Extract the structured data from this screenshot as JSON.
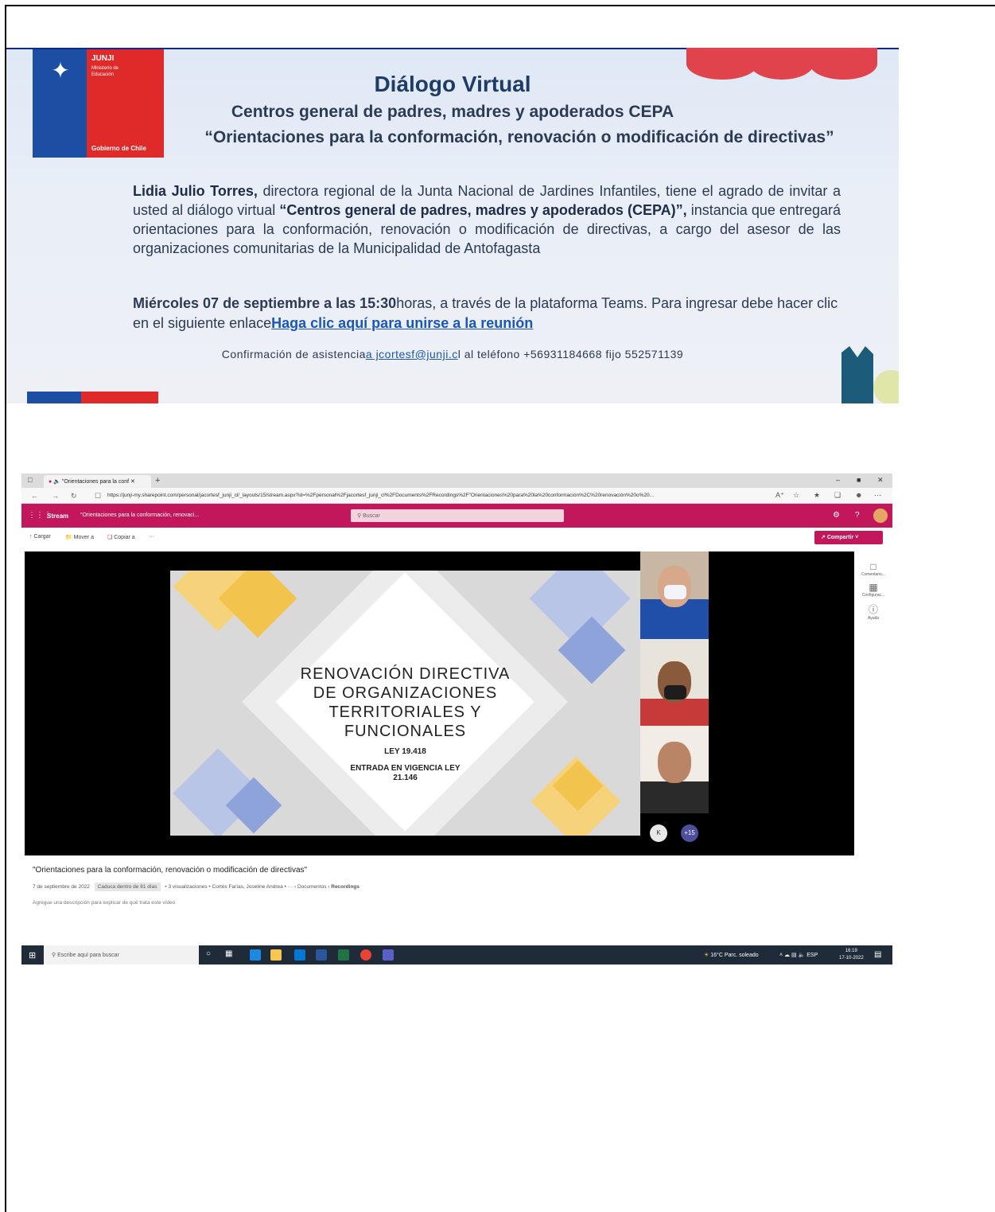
{
  "invitation": {
    "logo": {
      "brand": "JUNJI",
      "ministry": "Ministerio de Educación",
      "government": "Gobierno de Chile"
    },
    "title": "Diálogo Virtual",
    "subtitle": "Centros general de padres, madres y apoderados CEPA",
    "quote": "“Orientaciones para la conformación, renovación o modificación de directivas”",
    "body_name": "Lidia Julio Torres,",
    "body_text1": " directora regional de la Junta Nacional de Jardines Infantiles, tiene el agrado de invitar a usted al diálogo virtual ",
    "body_event": "“Centros general de padres, madres y apoderados (CEPA)”,",
    "body_text2": " instancia que entregará orientaciones para la conformación, renovación o modificación de directivas, a cargo del asesor de las organizaciones comunitarias de la Municipalidad de Antofagasta",
    "date_bold": "Miércoles 07 de septiembre a las 15:30",
    "date_text": "horas, a través de la plataforma Teams. Para ingresar debe hacer clic en el siguiente enlace",
    "join_link": "Haga clic aquí para unirse a la reunión",
    "confirm_prefix": "Confirmación de asistencia",
    "confirm_email": "a jcortesf@junji.c",
    "confirm_suffix": "l al teléfono +56931184668 fijo 552571139",
    "colors": {
      "flag_blue": "#1c4fa3",
      "flag_red": "#e02a2a",
      "title": "#1e3c66"
    }
  },
  "browser": {
    "tab_title": "\"Orientaciones para la conf",
    "url": "https://junji-my.sharepoint.com/personal/jacortesf_junji_cl/_layouts/15/stream.aspx?id=%2Fpersonal%2Fjacortesf_junji_cl%2FDocuments%2FRecordings%2F\"Orientaciones%20para%20la%20conformación%2C%20renovación%20o%20...",
    "suite": {
      "app_name": "Stream",
      "doc_name": "\"Orientaciones para la conformación, renovaci...",
      "search_placeholder": "Buscar",
      "accent": "#c2185b"
    },
    "commands": {
      "upload": "Cargar",
      "move": "Mover a",
      "copy": "Copiar a",
      "more": "···",
      "share": "Compartir"
    },
    "slide": {
      "heading": "RENOVACIÓN DIRECTIVA DE ORGANIZACIONES TERRITORIALES Y FUNCIONALES",
      "law": "LEY 19.418",
      "validity": "ENTRADA EN VIGENCIA LEY 21.146"
    },
    "participants": {
      "initial": "K",
      "overflow": "+15"
    },
    "side_panel": {
      "comments": "Comentario...",
      "settings": "Configurac...",
      "help": "Ayuda"
    },
    "video": {
      "title": "\"Orientaciones para la conformación, renovación o modificación de directivas\"",
      "date": "7 de septiembre de 2022",
      "expiry": "Caduca dentro de 81 días",
      "views": "3 visualizaciones",
      "author": "Cortés Farías, Joseline Andrea",
      "crumb_more": "···",
      "crumb_documents": "Documentos",
      "crumb_recordings": "Recordings",
      "description_placeholder": "Agregue una descripción para explicar de qué trata este vídeo"
    },
    "taskbar": {
      "search_placeholder": "Escribe aquí para buscar",
      "weather": "16°C  Parc. soleado",
      "language": "ESP",
      "time": "16:19",
      "date": "17-10-2022"
    }
  }
}
